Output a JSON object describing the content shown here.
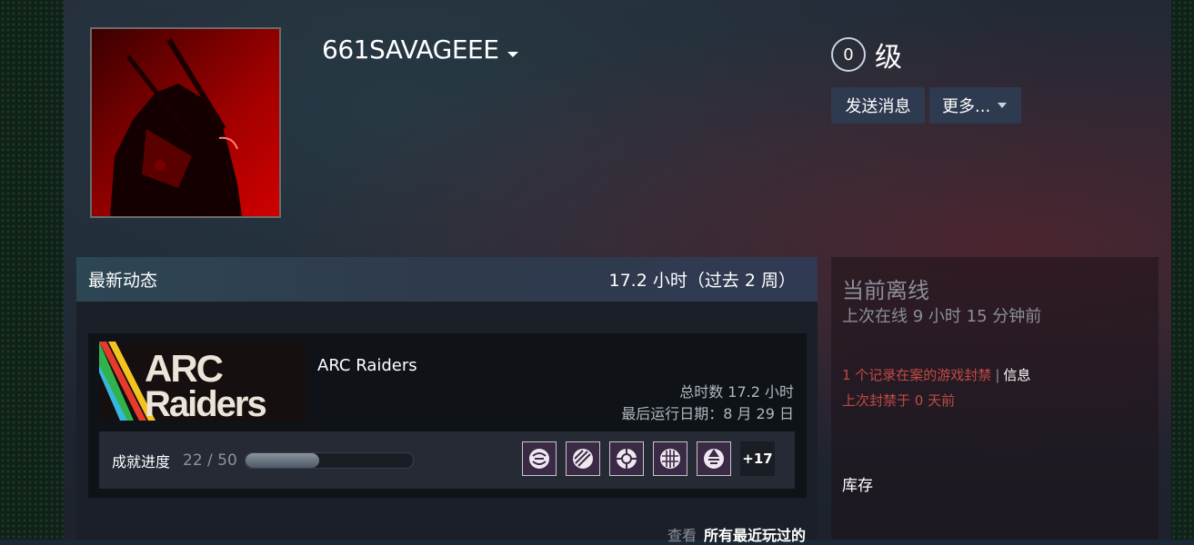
{
  "profile": {
    "username": "661SAVAGEEE",
    "level": "0",
    "level_label": "级",
    "avatar_alt": "avatar"
  },
  "actions": {
    "send_message": "发送消息",
    "more": "更多..."
  },
  "activity": {
    "title": "最新动态",
    "recent_hours": "17.2 小时（过去 2 周）",
    "game": {
      "name": "ARC Raiders",
      "logo_line1": "ARC",
      "logo_line2": "Raiders",
      "total_hours": "总时数 17.2 小时",
      "last_played": "最后运行日期：8 月 29 日"
    },
    "achievements": {
      "label": "成就进度",
      "count": "22 / 50",
      "progress_fraction": 0.44,
      "icons": [
        "achievement-1-icon",
        "achievement-2-icon",
        "achievement-3-icon",
        "achievement-4-icon",
        "achievement-5-icon"
      ],
      "more": "+17"
    },
    "view_prefix": "查看",
    "view_link": "所有最近玩过的"
  },
  "status": {
    "title": "当前离线",
    "last_online": "上次在线 9 小时 15 分钟前",
    "ban_record": "1 个记录在案的游戏封禁",
    "ban_separator": "|",
    "ban_info": "信息",
    "last_ban": "上次封禁于 0 天前",
    "inventory": "库存"
  },
  "colors": {
    "ban_red": "#c04a46",
    "button_bg": "#2e3a4f",
    "header_bg": "#2f3a4c"
  }
}
